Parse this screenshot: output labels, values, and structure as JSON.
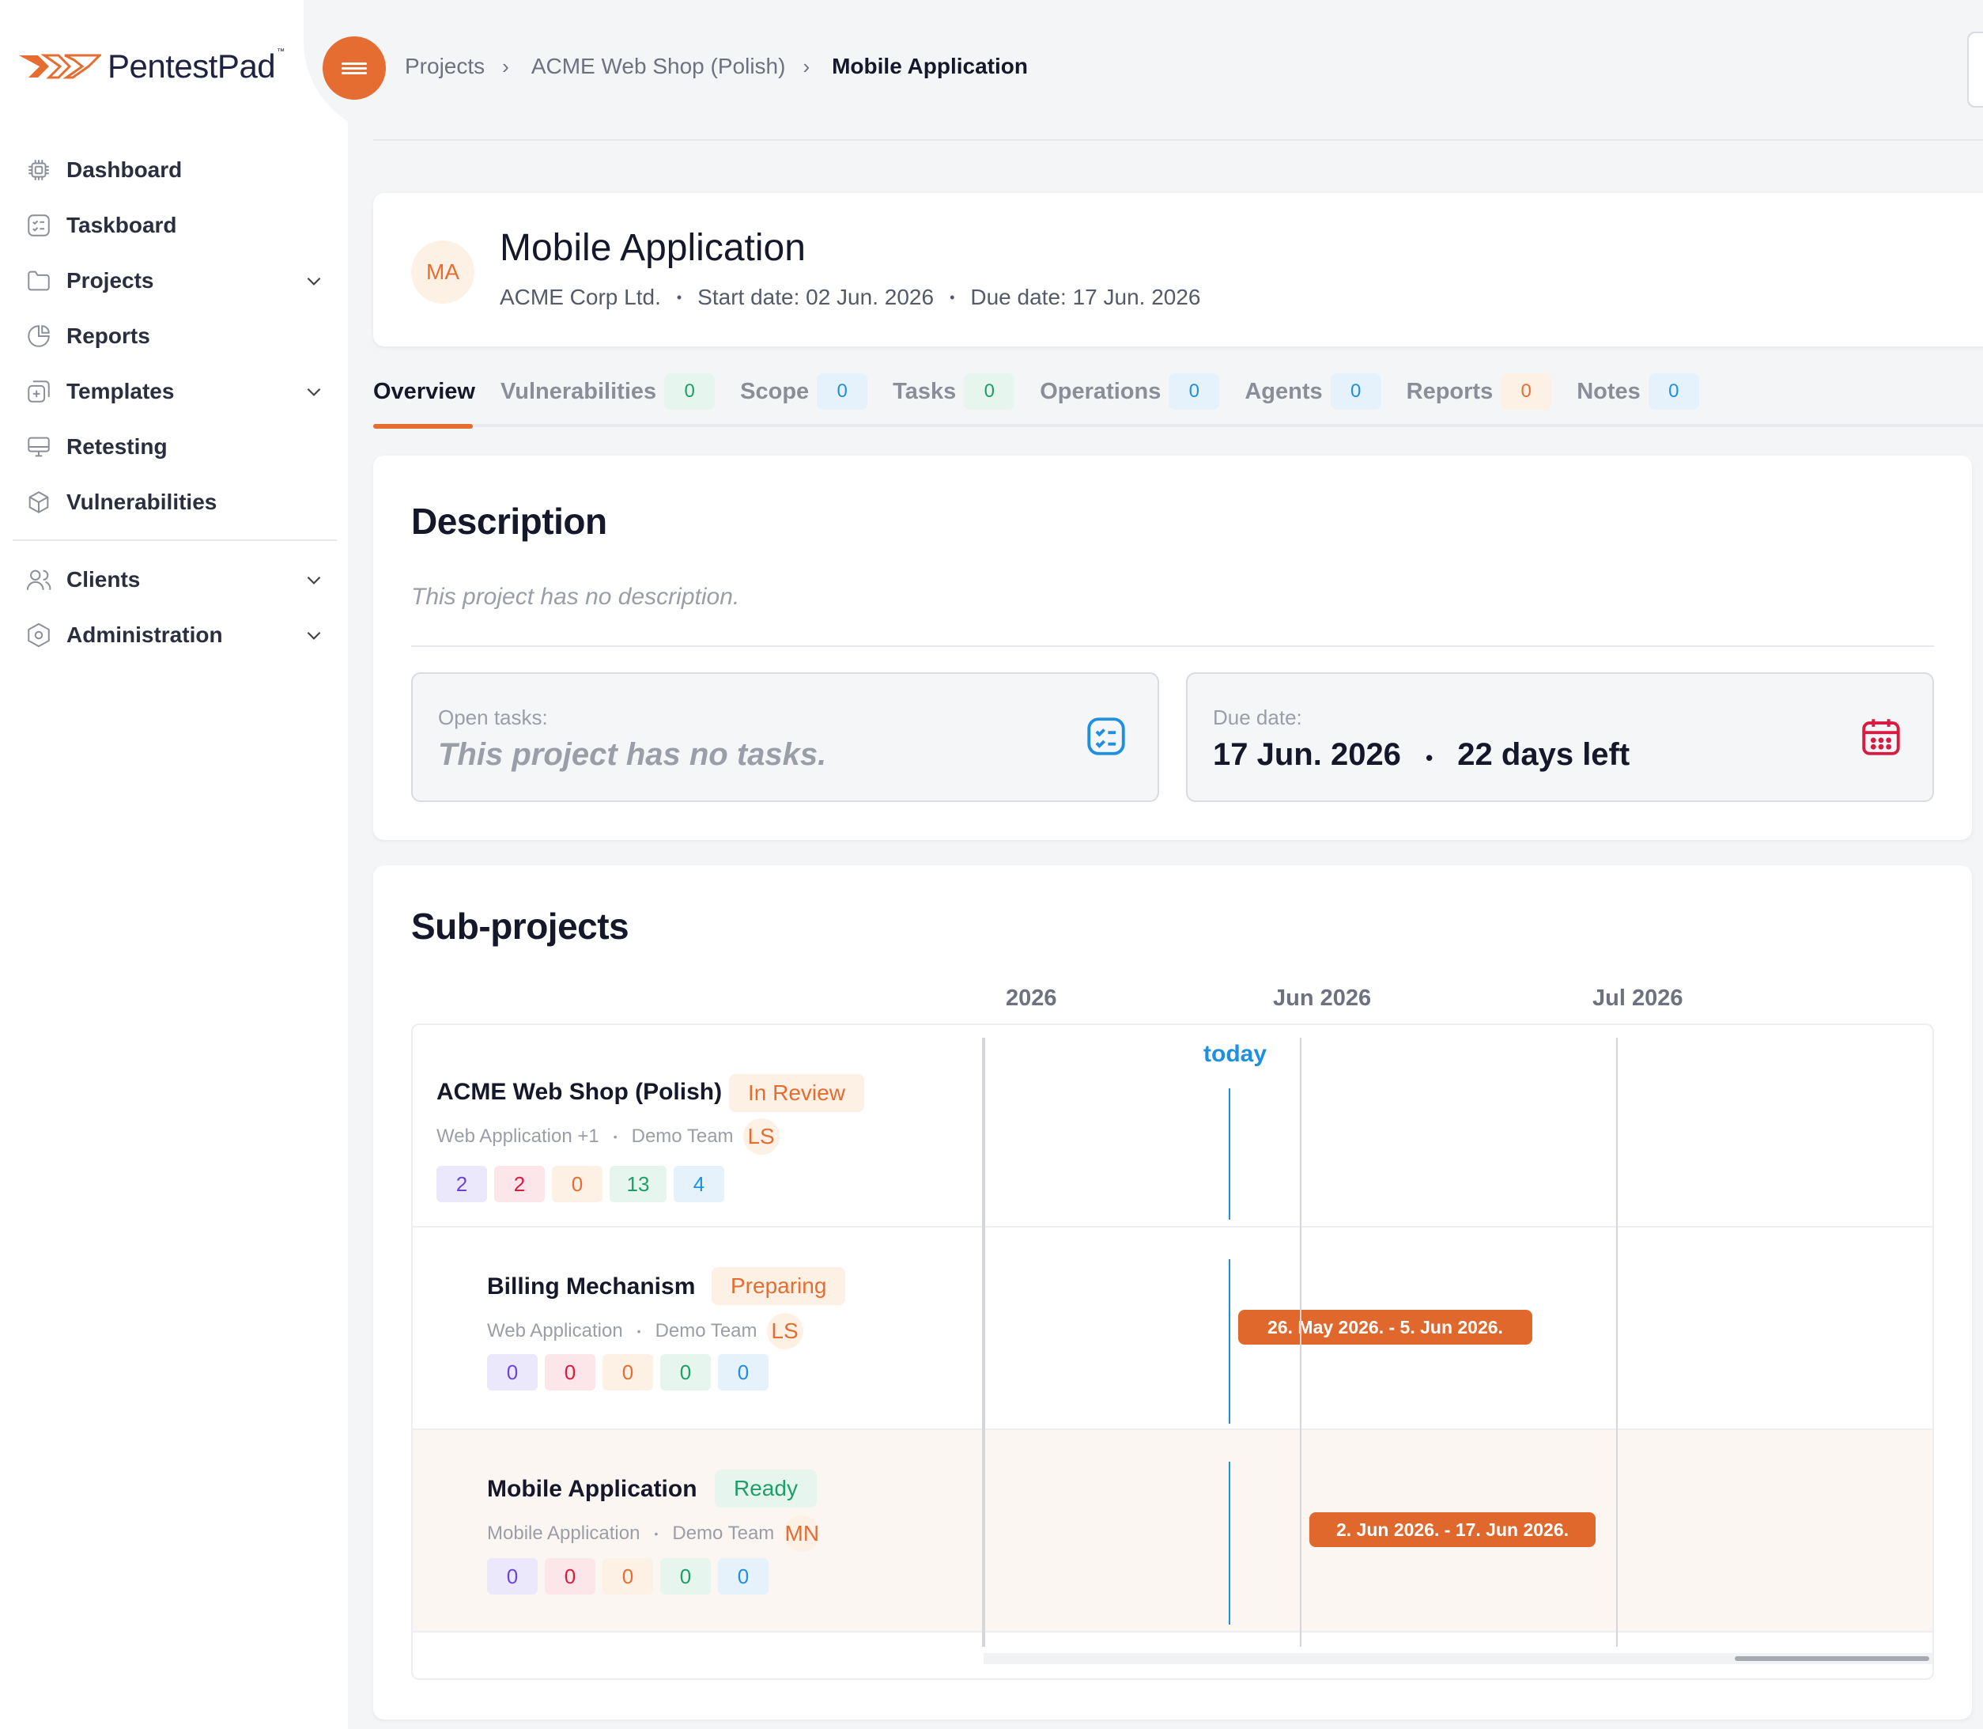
{
  "brand": {
    "name": "PentestPad",
    "tm": "™"
  },
  "sidebar": {
    "items": [
      {
        "label": "Dashboard",
        "icon": "chip-icon",
        "expandable": false
      },
      {
        "label": "Taskboard",
        "icon": "taskboard-icon",
        "expandable": false
      },
      {
        "label": "Projects",
        "icon": "folder-icon",
        "expandable": true
      },
      {
        "label": "Reports",
        "icon": "pie-chart-icon",
        "expandable": false
      },
      {
        "label": "Templates",
        "icon": "templates-icon",
        "expandable": true
      },
      {
        "label": "Retesting",
        "icon": "monitor-icon",
        "expandable": false
      },
      {
        "label": "Vulnerabilities",
        "icon": "cube-icon",
        "expandable": false
      }
    ],
    "items2": [
      {
        "label": "Clients",
        "icon": "users-icon",
        "expandable": true
      },
      {
        "label": "Administration",
        "icon": "hexagon-settings-icon",
        "expandable": true
      }
    ]
  },
  "breadcrumb": {
    "items": [
      "Projects",
      "ACME Web Shop (Polish)"
    ],
    "current": "Mobile Application"
  },
  "header": {
    "avatar": "MA",
    "title": "Mobile Application",
    "client": "ACME Corp Ltd.",
    "start": "Start date: 02 Jun. 2026",
    "due": "Due date: 17 Jun. 2026"
  },
  "tabs": [
    {
      "label": "Overview",
      "count": null
    },
    {
      "label": "Vulnerabilities",
      "count": "0",
      "color": "green"
    },
    {
      "label": "Scope",
      "count": "0",
      "color": "blue"
    },
    {
      "label": "Tasks",
      "count": "0",
      "color": "green"
    },
    {
      "label": "Operations",
      "count": "0",
      "color": "blue"
    },
    {
      "label": "Agents",
      "count": "0",
      "color": "blue"
    },
    {
      "label": "Reports",
      "count": "0",
      "color": "orange"
    },
    {
      "label": "Notes",
      "count": "0",
      "color": "blue"
    }
  ],
  "description": {
    "title": "Description",
    "text": "This project has no description.",
    "open_tasks_label": "Open tasks:",
    "open_tasks_value": "This project has no tasks.",
    "due_label": "Due date:",
    "due_value": "17 Jun. 2026",
    "days_left": "22 days left"
  },
  "subprojects": {
    "title": "Sub-projects",
    "timeline_headers": [
      "2026",
      "Jun 2026",
      "Jul 2026"
    ],
    "today_label": "today",
    "rows": [
      {
        "name": "ACME Web Shop (Polish)",
        "status": "In Review",
        "type": "Web Application +1",
        "team": "Demo Team",
        "initials": "LS",
        "counts": [
          "2",
          "2",
          "0",
          "13",
          "4"
        ],
        "bar": null
      },
      {
        "name": "Billing Mechanism",
        "status": "Preparing",
        "type": "Web Application",
        "team": "Demo Team",
        "initials": "LS",
        "counts": [
          "0",
          "0",
          "0",
          "0",
          "0"
        ],
        "bar": "26. May 2026. - 5. Jun 2026."
      },
      {
        "name": "Mobile Application",
        "status": "Ready",
        "type": "Mobile Application",
        "team": "Demo Team",
        "initials": "MN",
        "counts": [
          "0",
          "0",
          "0",
          "0",
          "0"
        ],
        "bar": "2. Jun 2026. - 17. Jun 2026."
      }
    ]
  },
  "colors": {
    "accent": "#e66d31",
    "today": "#1f8fe0",
    "ready": "#1e9e6a"
  }
}
